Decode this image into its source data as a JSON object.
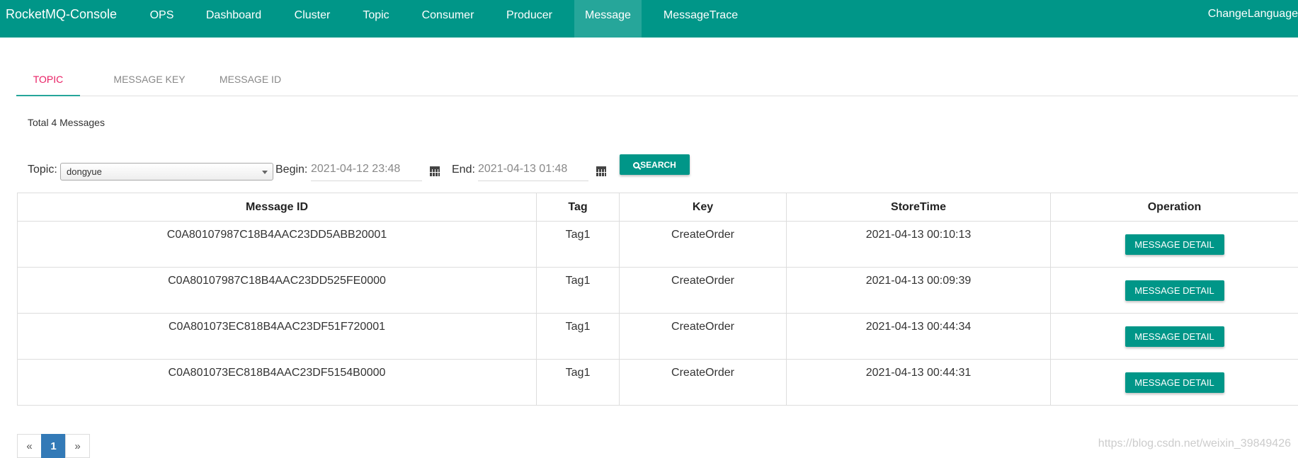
{
  "navbar": {
    "brand": "RocketMQ-Console",
    "items": [
      "OPS",
      "Dashboard",
      "Cluster",
      "Topic",
      "Consumer",
      "Producer",
      "Message",
      "MessageTrace"
    ],
    "active_item": "Message",
    "change_language": "ChangeLanguage",
    "color": "#009688"
  },
  "tabs": [
    {
      "label": "TOPIC",
      "active": true
    },
    {
      "label": "MESSAGE KEY",
      "active": false
    },
    {
      "label": "MESSAGE ID",
      "active": false
    }
  ],
  "summary": {
    "total": "Total 4 Messages"
  },
  "filters": {
    "topic_label": "Topic:",
    "topic_value": "dongyue",
    "begin_label": "Begin:",
    "begin_value": "2021-04-12 23:48",
    "end_label": "End:",
    "end_value": "2021-04-13 01:48",
    "search_label": "SEARCH"
  },
  "table": {
    "columns": [
      "Message ID",
      "Tag",
      "Key",
      "StoreTime",
      "Operation"
    ],
    "rows": [
      {
        "message_id": "C0A80107987C18B4AAC23DD5ABB20001",
        "tag": "Tag1",
        "key": "CreateOrder",
        "store_time": "2021-04-13 00:10:13",
        "action": "MESSAGE DETAIL"
      },
      {
        "message_id": "C0A80107987C18B4AAC23DD525FE0000",
        "tag": "Tag1",
        "key": "CreateOrder",
        "store_time": "2021-04-13 00:09:39",
        "action": "MESSAGE DETAIL"
      },
      {
        "message_id": "C0A801073EC818B4AAC23DF51F720001",
        "tag": "Tag1",
        "key": "CreateOrder",
        "store_time": "2021-04-13 00:44:34",
        "action": "MESSAGE DETAIL"
      },
      {
        "message_id": "C0A801073EC818B4AAC23DF5154B0000",
        "tag": "Tag1",
        "key": "CreateOrder",
        "store_time": "2021-04-13 00:44:31",
        "action": "MESSAGE DETAIL"
      }
    ]
  },
  "pagination": {
    "prev": "«",
    "current": "1",
    "next": "»"
  },
  "watermark": "https://blog.csdn.net/weixin_39849426"
}
